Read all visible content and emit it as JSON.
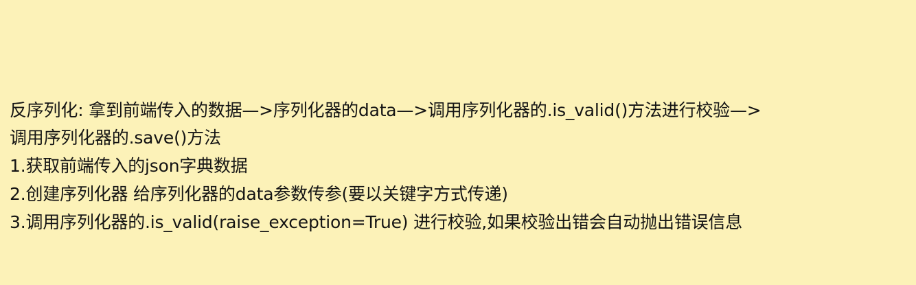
{
  "note": {
    "lines": [
      "反序列化: 拿到前端传入的数据—>序列化器的data—>调用序列化器的.is_valid()方法进行校验—>",
      "调用序列化器的.save()方法",
      "1.获取前端传入的json字典数据",
      "2.创建序列化器 给序列化器的data参数传参(要以关键字方式传递)",
      "3.调用序列化器的.is_valid(raise_exception=True) 进行校验,如果校验出错会自动抛出错误信息"
    ]
  }
}
